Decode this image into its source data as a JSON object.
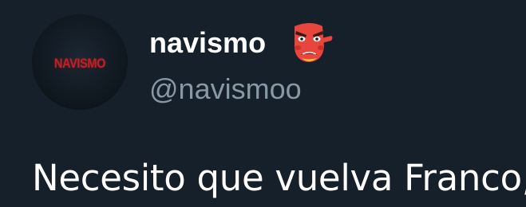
{
  "tweet": {
    "author": {
      "display_name": "navismo",
      "handle": "@navismoo",
      "avatar_text": "NAVISMO",
      "name_emoji": "tengu-mask-emoji"
    },
    "text": "Necesito que vuelva Franco,"
  },
  "colors": {
    "background": "#15202b",
    "primary_text": "#ffffff",
    "secondary_text": "#8899a6",
    "avatar_logo": "#c41f24"
  }
}
